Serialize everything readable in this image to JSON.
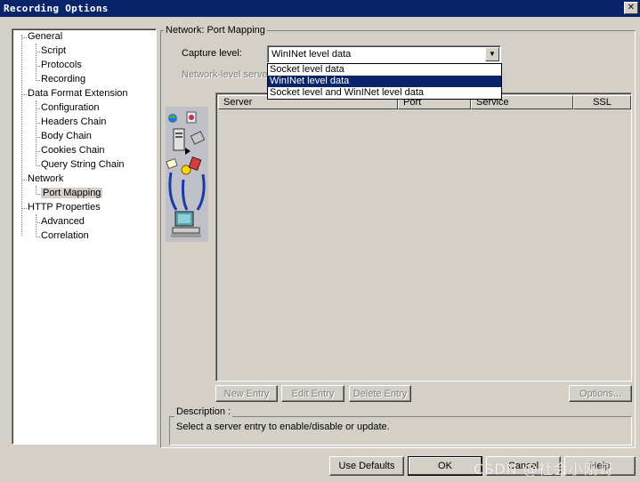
{
  "window": {
    "title": "Recording Options",
    "close_glyph": "✕"
  },
  "tree": {
    "items": [
      {
        "label": "General",
        "level": 0
      },
      {
        "label": "Script",
        "level": 1
      },
      {
        "label": "Protocols",
        "level": 1
      },
      {
        "label": "Recording",
        "level": 1
      },
      {
        "label": "Data Format Extension",
        "level": 0
      },
      {
        "label": "Configuration",
        "level": 1
      },
      {
        "label": "Headers Chain",
        "level": 1
      },
      {
        "label": "Body Chain",
        "level": 1
      },
      {
        "label": "Cookies Chain",
        "level": 1
      },
      {
        "label": "Query String Chain",
        "level": 1
      },
      {
        "label": "Network",
        "level": 0
      },
      {
        "label": "Port Mapping",
        "level": 1,
        "selected": true
      },
      {
        "label": "HTTP Properties",
        "level": 0
      },
      {
        "label": "Advanced",
        "level": 1
      },
      {
        "label": "Correlation",
        "level": 1
      }
    ]
  },
  "panel": {
    "group_title": "Network: Port Mapping",
    "capture_label": "Capture level:",
    "capture_value": "WinINet level data",
    "capture_options": [
      {
        "label": "Socket level data",
        "selected": false
      },
      {
        "label": "WinINet level data",
        "selected": true
      },
      {
        "label": "Socket level and WinINet level data",
        "selected": false
      }
    ],
    "network_server_label": "Network-level serve"
  },
  "list": {
    "columns": [
      "Server",
      "Port",
      "Service",
      "SSL"
    ]
  },
  "entry_buttons": {
    "new_entry": "New Entry",
    "edit_entry": "Edit Entry",
    "delete_entry": "Delete Entry",
    "options": "Options..."
  },
  "description": {
    "title": "Description :",
    "text": "Select a server entry to enable/disable or update."
  },
  "dialog_buttons": {
    "use_defaults": "Use Defaults",
    "ok": "OK",
    "cancel": "Cancel",
    "help": "Help"
  },
  "watermark": "CSDN @社会小刚哥",
  "colors": {
    "title_bar": "#0a246a",
    "selection": "#0a246a",
    "face": "#d4d0c8"
  }
}
